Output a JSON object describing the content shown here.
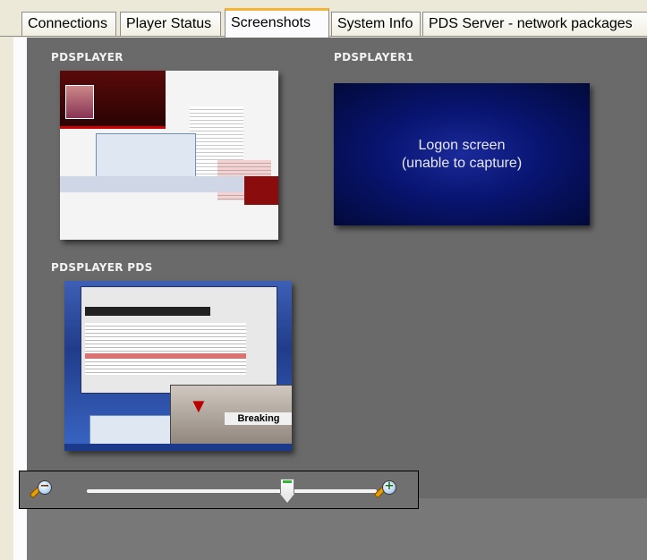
{
  "tabs": [
    {
      "label": "Connections",
      "active": false
    },
    {
      "label": "Player Status",
      "active": false
    },
    {
      "label": "Screenshots",
      "active": true
    },
    {
      "label": "System Info",
      "active": false
    },
    {
      "label": "PDS Server - network packages",
      "active": false
    }
  ],
  "screens": [
    {
      "name": "PDSPLAYER"
    },
    {
      "name": "PDSPLAYER1",
      "message_line1": "Logon screen",
      "message_line2": "(unable to capture)"
    },
    {
      "name": "PDSPLAYER PDS",
      "banner": "Breaking"
    }
  ],
  "zoom": {
    "level": 0.69,
    "zoom_out_icon": "magnifier-minus-icon",
    "zoom_in_icon": "magnifier-plus-icon",
    "minus_glyph": "−",
    "plus_glyph": "+"
  },
  "colors": {
    "tab_active_accent": "#f5b436",
    "viewer_background": "#6a6a6a",
    "logon_screen_blue": "#081470"
  }
}
